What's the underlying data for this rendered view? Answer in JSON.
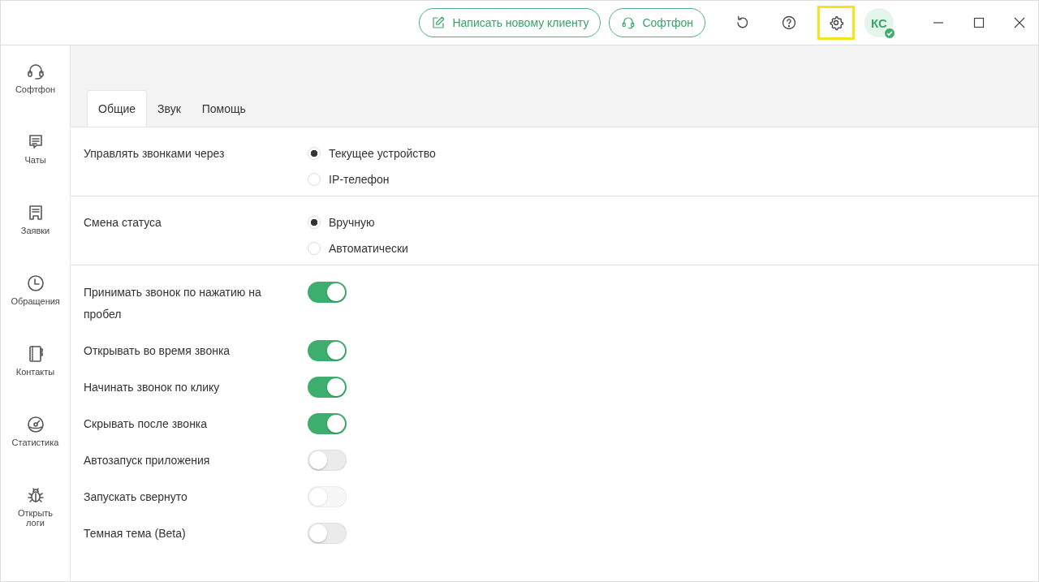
{
  "header": {
    "buttons": [
      {
        "kind": "compose",
        "label": "Написать новому клиенту"
      },
      {
        "kind": "headset",
        "label": "Софтфон"
      }
    ],
    "tools": [
      {
        "kind": "refresh",
        "highlighted": false
      },
      {
        "kind": "help",
        "highlighted": false
      },
      {
        "kind": "settings",
        "highlighted": true
      }
    ],
    "avatar": {
      "initials": "КС",
      "online": true
    }
  },
  "sidebar": {
    "items": [
      {
        "kind": "headset",
        "label": "Софтфон"
      },
      {
        "kind": "chat",
        "label": "Чаты"
      },
      {
        "kind": "ticket",
        "label": "Заявки"
      },
      {
        "kind": "clock",
        "label": "Обращения"
      },
      {
        "kind": "contacts",
        "label": "Контакты"
      },
      {
        "kind": "gauge",
        "label": "Статистика"
      },
      {
        "kind": "bug",
        "label": "Открыть логи"
      }
    ]
  },
  "tabs": [
    {
      "label": "Общие",
      "selected": true
    },
    {
      "label": "Звук",
      "selected": false
    },
    {
      "label": "Помощь",
      "selected": false
    }
  ],
  "radio_groups": [
    {
      "label": "Управлять звонками через",
      "options": [
        {
          "label": "Текущее устройство",
          "selected": true
        },
        {
          "label": "IP-телефон",
          "selected": false
        }
      ]
    },
    {
      "label": "Смена статуса",
      "options": [
        {
          "label": "Вручную",
          "selected": true
        },
        {
          "label": "Автоматически",
          "selected": false
        }
      ]
    }
  ],
  "toggles": [
    {
      "label": "Принимать звонок по нажатию на пробел",
      "on": true,
      "disabled": false
    },
    {
      "label": "Открывать во время звонка",
      "on": true,
      "disabled": false
    },
    {
      "label": "Начинать звонок по клику",
      "on": true,
      "disabled": false
    },
    {
      "label": "Скрывать после звонка",
      "on": true,
      "disabled": false
    },
    {
      "label": "Автозапуск приложения",
      "on": false,
      "disabled": false
    },
    {
      "label": "Запускать свернуто",
      "on": false,
      "disabled": true
    },
    {
      "label": "Темная тема (Beta)",
      "on": false,
      "disabled": false
    }
  ]
}
